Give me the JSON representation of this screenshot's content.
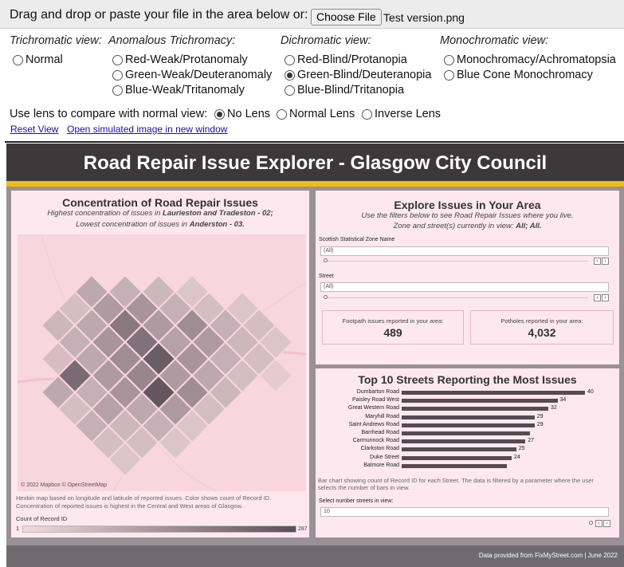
{
  "upload": {
    "prompt": "Drag and drop or paste your file in the area below or:",
    "button": "Choose File",
    "filename": "Test version.png"
  },
  "views": {
    "trichromatic": {
      "title": "Trichromatic view:",
      "options": [
        "Normal"
      ]
    },
    "anomalous": {
      "title": "Anomalous Trichromacy:",
      "options": [
        "Red-Weak/Protanomaly",
        "Green-Weak/Deuteranomaly",
        "Blue-Weak/Tritanomaly"
      ]
    },
    "dichromatic": {
      "title": "Dichromatic view:",
      "options": [
        "Red-Blind/Protanopia",
        "Green-Blind/Deuteranopia",
        "Blue-Blind/Tritanopia"
      ]
    },
    "monochromatic": {
      "title": "Monochromatic view:",
      "options": [
        "Monochromacy/Achromatopsia",
        "Blue Cone Monochromacy"
      ]
    },
    "selected": "Green-Blind/Deuteranopia"
  },
  "lens": {
    "label": "Use lens to compare with normal view:",
    "options": [
      "No Lens",
      "Normal Lens",
      "Inverse Lens"
    ],
    "selected": "No Lens"
  },
  "links": {
    "reset": "Reset View",
    "open": "Open simulated image in new window"
  },
  "dashboard": {
    "title": "Road Repair Issue Explorer - Glasgow City Council",
    "footer": "Data provided from FixMyStreet.com | June 2022",
    "colors": {
      "header": "#3d393b",
      "accent": "#efbd10",
      "panel": "#fde8ef",
      "bar": "#564c50"
    },
    "map_panel": {
      "title": "Concentration of Road Repair Issues",
      "sub1_pre": "Highest concentration of issues in ",
      "sub1_bold": "Laurieston and Tradeston - 02;",
      "sub2_pre": "Lowest concentration of issues in ",
      "sub2_bold": "Anderston - 03.",
      "credit": "© 2022 Mapbox © OpenStreetMap",
      "caption1": "Hexbin map based on longitude and latitude of reported issues.  Color shows count of Record ID.",
      "caption2": "Concentration of reported issues is highest in the Central and West areas of Glasgow.",
      "legend_title": "Count of Record ID",
      "legend_min": "1",
      "legend_max": "287"
    },
    "explore_panel": {
      "title": "Explore Issues in Your Area",
      "sub1": "Use the filters below to see Road Repair Issues where you live.",
      "sub2_pre": "Zone and street(s) currently in view: ",
      "sub2_bold": "All; All.",
      "filter1_label": "Scottish Statistical Zone Name",
      "filter1_value": "(All)",
      "filter2_label": "Street",
      "filter2_value": "(All)",
      "kpi1_label": "Footpath issues reported in your area:",
      "kpi1_value": "489",
      "kpi2_label": "Potholes reported in your area:",
      "kpi2_value": "4,032"
    },
    "streets_panel": {
      "title": "Top 10 Streets Reporting the Most Issues",
      "caption1": "Bar chart showing count of Record ID for each Street. The data is filtered by a parameter where the user",
      "caption2": "selects the number of bars in view.",
      "select_label": "Select number streets in view:",
      "select_value": "10"
    }
  },
  "chart_data": {
    "type": "bar",
    "title": "Top 10 Streets Reporting the Most Issues",
    "categories": [
      "Dumbarton Road",
      "Paisley Road West",
      "Great Western Road",
      "Maryhill Road",
      "Saint Andrews Road",
      "Barrhead Road",
      "Carmunnock Road",
      "Clarkston Road",
      "Duke Street",
      "Balmore Road"
    ],
    "values": [
      40,
      34,
      32,
      29,
      29,
      28,
      27,
      25,
      24,
      23
    ],
    "data_labels": [
      "40",
      "34",
      "32",
      "29",
      "29",
      "",
      "27",
      "25",
      "24",
      ""
    ],
    "orientation": "horizontal"
  }
}
